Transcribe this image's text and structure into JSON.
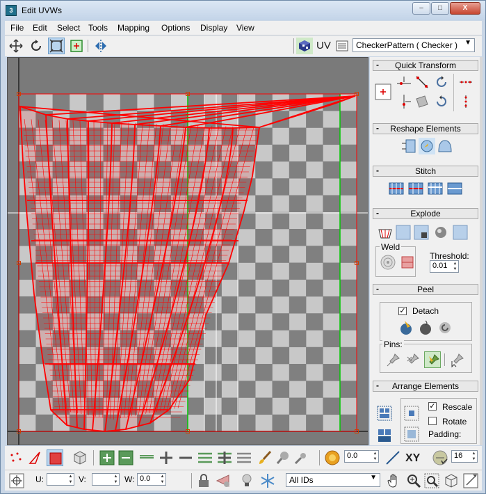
{
  "window": {
    "title": "Edit UVWs",
    "app_icon_letter": "3",
    "controls": {
      "minimize": "–",
      "maximize": "□",
      "close": "X"
    }
  },
  "menu": [
    "File",
    "Edit",
    "Select",
    "Tools",
    "Mapping",
    "Options",
    "Display",
    "View"
  ],
  "toolbar": {
    "uv_label": "UV",
    "texture_dropdown": "CheckerPattern  ( Checker )"
  },
  "panel": {
    "quick_transform": {
      "title": "Quick Transform"
    },
    "reshape": {
      "title": "Reshape Elements"
    },
    "stitch": {
      "title": "Stitch"
    },
    "explode": {
      "title": "Explode",
      "weld_label": "Weld",
      "threshold_label": "Threshold:",
      "threshold_value": "0.01"
    },
    "peel": {
      "title": "Peel",
      "detach_label": "Detach",
      "detach_checked": true,
      "pins_label": "Pins:"
    },
    "arrange": {
      "title": "Arrange Elements",
      "rescale_label": "Rescale",
      "rescale_checked": true,
      "rotate_label": "Rotate",
      "rotate_checked": false,
      "padding_label": "Padding:"
    }
  },
  "bottom": {
    "soft_value": "0.0",
    "xy_label": "XY",
    "grid_value": "16",
    "u_label": "U:",
    "v_label": "V:",
    "w_label": "W:",
    "u_value": "",
    "v_value": "",
    "w_value": "0.0",
    "ids_dropdown": "All IDs"
  },
  "colors": {
    "uv_wire": "#ff0000",
    "checker_dark": "#808080",
    "checker_light": "#c8c8c8",
    "seam_green": "#00c800",
    "selected_button": "#b8d4ee"
  }
}
